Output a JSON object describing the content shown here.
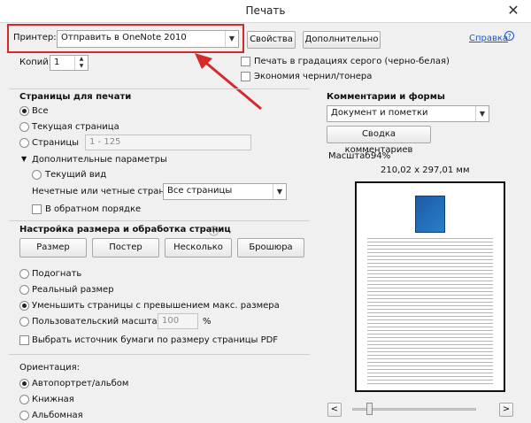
{
  "window": {
    "title": "Печать",
    "close_glyph": "✕"
  },
  "printer": {
    "label": "Принтер:",
    "value": "Отправить в OneNote 2010",
    "properties_btn": "Свойства",
    "advanced_btn": "Дополнительно",
    "help_link": "Справка"
  },
  "copies": {
    "label": "Копий:",
    "value": "1"
  },
  "options": {
    "grayscale": "Печать в градациях серого (черно-белая)",
    "save_ink": "Экономия чернил/тонера"
  },
  "pages_section": {
    "header": "Страницы для печати",
    "all": "Все",
    "current": "Текущая страница",
    "pages": "Страницы",
    "pages_range": "1 - 125",
    "more_options": "Дополнительные параметры",
    "current_view": "Текущий вид",
    "odd_even_label": "Нечетные или четные страницы:",
    "odd_even_value": "Все страницы",
    "reverse": "В обратном порядке"
  },
  "sizing_section": {
    "header": "Настройка размера и обработка страниц",
    "info_icon": "ⓘ",
    "tabs": [
      "Размер",
      "Постер",
      "Несколько",
      "Брошюра"
    ],
    "fit": "Подогнать",
    "actual_size": "Реальный размер",
    "shrink": "Уменьшить страницы с превышением макс. размера",
    "custom_scale": "Пользовательский масштаб:",
    "custom_scale_value": "100",
    "percent": "%",
    "paper_source": "Выбрать источник бумаги по размеру страницы PDF"
  },
  "orientation": {
    "header": "Ориентация:",
    "auto": "Автопортрет/альбом",
    "portrait": "Книжная",
    "landscape": "Альбомная"
  },
  "comments": {
    "header": "Комментарии и формы",
    "value": "Документ и пометки",
    "summary_btn": "Сводка комментариев"
  },
  "preview": {
    "scale_label": "Масштаб:",
    "scale_value": "94%",
    "dimensions": "210,02 x 297,01 мм",
    "prev": "<",
    "next": ">"
  },
  "colors": {
    "annotation": "#d42a2a",
    "link": "#1a56c5"
  }
}
